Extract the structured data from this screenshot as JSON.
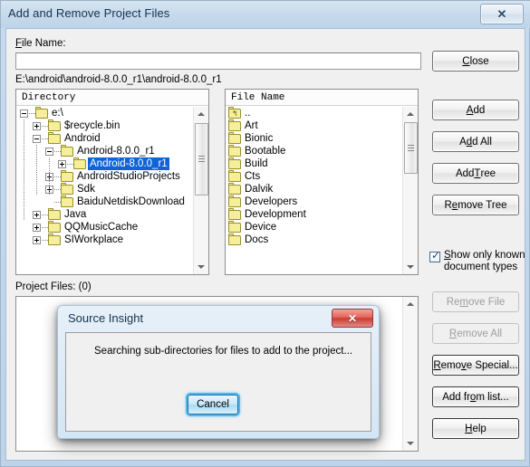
{
  "window": {
    "title": "Add and Remove Project Files",
    "close_glyph": "✕",
    "close_name": "close"
  },
  "form": {
    "file_name_label": "File Name:",
    "file_name_value": "",
    "file_name_placeholder": "",
    "current_path": "E:\\android\\android-8.0.0_r1\\android-8.0.0_r1",
    "project_files_label": "Project Files: (0)"
  },
  "directory_panel": {
    "header": "Directory",
    "items": [
      {
        "label": "e:\\",
        "depth": 0,
        "state": "minus",
        "selected": false
      },
      {
        "label": "$recycle.bin",
        "depth": 1,
        "state": "plus",
        "selected": false
      },
      {
        "label": "Android",
        "depth": 1,
        "state": "minus",
        "selected": false
      },
      {
        "label": "Android-8.0.0_r1",
        "depth": 2,
        "state": "minus",
        "selected": false
      },
      {
        "label": "Android-8.0.0_r1",
        "depth": 3,
        "state": "plus",
        "selected": true
      },
      {
        "label": "AndroidStudioProjects",
        "depth": 2,
        "state": "plus",
        "selected": false
      },
      {
        "label": "Sdk",
        "depth": 2,
        "state": "plus",
        "selected": false
      },
      {
        "label": "BaiduNetdiskDownload",
        "depth": 2,
        "state": "none",
        "selected": false
      },
      {
        "label": "Java",
        "depth": 1,
        "state": "plus",
        "selected": false
      },
      {
        "label": "QQMusicCache",
        "depth": 1,
        "state": "plus",
        "selected": false
      },
      {
        "label": "SIWorkplace",
        "depth": 1,
        "state": "plus",
        "selected": false
      }
    ]
  },
  "file_panel": {
    "header": "File Name",
    "items": [
      {
        "label": "..",
        "icon": "folder-up-icon"
      },
      {
        "label": "Art",
        "icon": "folder-icon"
      },
      {
        "label": "Bionic",
        "icon": "folder-icon"
      },
      {
        "label": "Bootable",
        "icon": "folder-icon"
      },
      {
        "label": "Build",
        "icon": "folder-icon"
      },
      {
        "label": "Cts",
        "icon": "folder-icon"
      },
      {
        "label": "Dalvik",
        "icon": "folder-icon"
      },
      {
        "label": "Developers",
        "icon": "folder-icon"
      },
      {
        "label": "Development",
        "icon": "folder-icon"
      },
      {
        "label": "Device",
        "icon": "folder-icon"
      },
      {
        "label": "Docs",
        "icon": "folder-icon"
      }
    ]
  },
  "buttons": {
    "close": {
      "label": "Close",
      "enabled": true
    },
    "add": {
      "label": "Add",
      "enabled": true
    },
    "add_all": {
      "label": "Add All",
      "enabled": true
    },
    "add_tree": {
      "label": "Add Tree",
      "enabled": true
    },
    "remove_tree": {
      "label": "Remove Tree",
      "enabled": true
    },
    "remove_file": {
      "label": "Remove File",
      "enabled": false
    },
    "remove_all": {
      "label": "Remove All",
      "enabled": false
    },
    "remove_special": {
      "label": "Remove Special...",
      "enabled": true
    },
    "add_from_list": {
      "label": "Add from list...",
      "enabled": true
    },
    "help": {
      "label": "Help",
      "enabled": true
    }
  },
  "checkbox": {
    "label": "Show only known document types",
    "checked": true,
    "tick_glyph": "✓"
  },
  "dialog": {
    "title": "Source Insight",
    "message": "Searching sub-directories for files to add to the project...",
    "cancel_label": "Cancel",
    "close_glyph": "✕"
  },
  "colors": {
    "title_bar": "#c6d9ec",
    "selection": "#1064d8",
    "dialog_close": "#c93b32",
    "focus_glow": "#49b9ef",
    "folder": "#f5ee9a"
  }
}
